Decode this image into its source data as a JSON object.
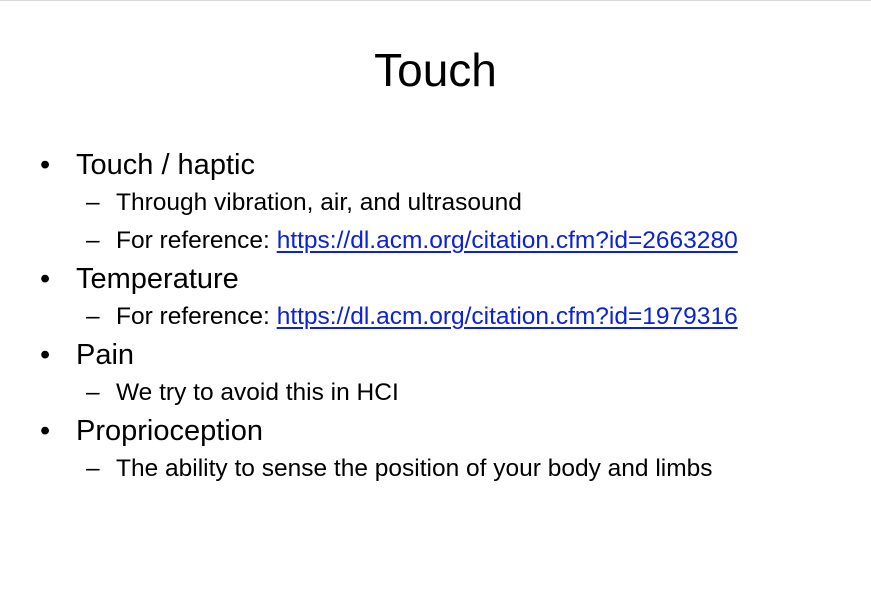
{
  "slide": {
    "title": "Touch",
    "level1_marker": "•",
    "level2_marker": "–",
    "items": [
      {
        "label": "Touch / haptic",
        "subitems": [
          {
            "text": "Through vibration, air, and ultrasound"
          },
          {
            "text": "For reference: ",
            "link": "https://dl.acm.org/citation.cfm?id=2663280"
          }
        ]
      },
      {
        "label": "Temperature",
        "subitems": [
          {
            "text": "For reference: ",
            "link": "https://dl.acm.org/citation.cfm?id=1979316"
          }
        ]
      },
      {
        "label": "Pain",
        "subitems": [
          {
            "text": "We try to avoid this in HCI"
          }
        ]
      },
      {
        "label": "Proprioception",
        "subitems": [
          {
            "text": "The ability to sense the position of your body and limbs"
          }
        ]
      }
    ]
  },
  "colors": {
    "text": "#000000",
    "link": "#0b22d6",
    "background": "#ffffff"
  }
}
